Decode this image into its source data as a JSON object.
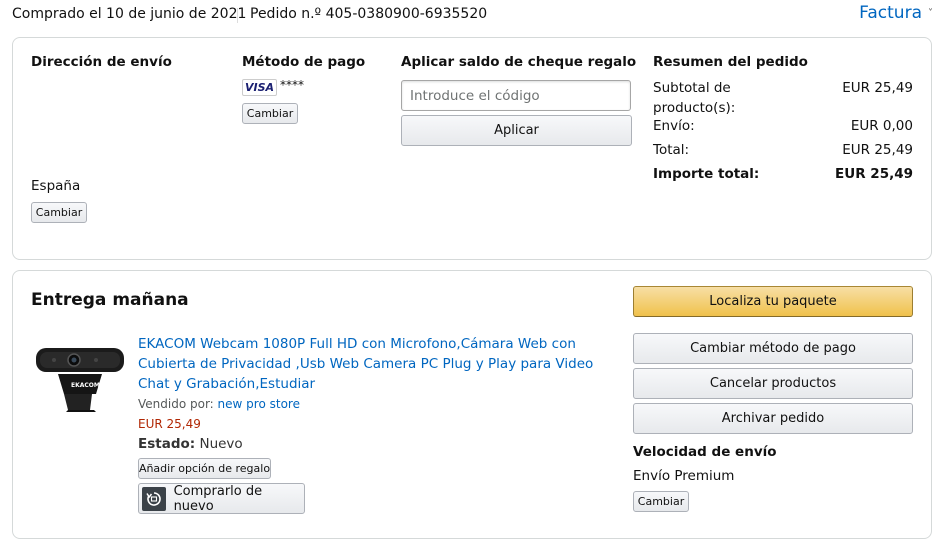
{
  "header": {
    "order_date": "Comprado el 10 de junio de 2021",
    "order_number": "Pedido n.º 405-0380900-6935520",
    "invoice_label": "Factura"
  },
  "summary_box": {
    "shipping_address": {
      "title": "Dirección de envío",
      "country": "España",
      "change_label": "Cambiar"
    },
    "payment": {
      "title": "Método de pago",
      "card_brand": "VISA",
      "card_digits": "****",
      "change_label": "Cambiar"
    },
    "gift_card": {
      "title": "Aplicar saldo de cheque regalo",
      "placeholder": "Introduce el código",
      "apply_label": "Aplicar"
    },
    "order_summary": {
      "title": "Resumen del pedido",
      "rows": [
        {
          "label": "Subtotal de producto(s):",
          "value": "EUR 25,49"
        },
        {
          "label": "Envío:",
          "value": "EUR 0,00"
        },
        {
          "label": "Total:",
          "value": "EUR 25,49"
        }
      ],
      "grand_total": {
        "label": "Importe total:",
        "value": "EUR 25,49"
      }
    }
  },
  "shipment": {
    "title": "Entrega mañana",
    "product": {
      "name": "EKACOM Webcam 1080P Full HD con Microfono,Cámara Web con Cubierta de Privacidad ,Usb Web Camera PC Plug y Play para Video Chat y Grabación,Estudiar",
      "image_brand": "EKACOM",
      "sold_by_label": "Vendido por:",
      "seller": "new pro store",
      "price": "EUR 25,49",
      "condition_label": "Estado:",
      "condition": "Nuevo",
      "gift_option_label": "Añadir opción de regalo",
      "buy_again_label": "Comprarlo de nuevo"
    },
    "actions": {
      "track": "Localiza tu paquete",
      "change_payment": "Cambiar método de pago",
      "cancel": "Cancelar productos",
      "archive": "Archivar pedido"
    },
    "shipping_speed": {
      "title": "Velocidad de envío",
      "value": "Envío Premium",
      "change_label": "Cambiar"
    }
  },
  "colors": {
    "link": "#0066c0",
    "price": "#b12704",
    "primary_button": "#f0c14b"
  }
}
